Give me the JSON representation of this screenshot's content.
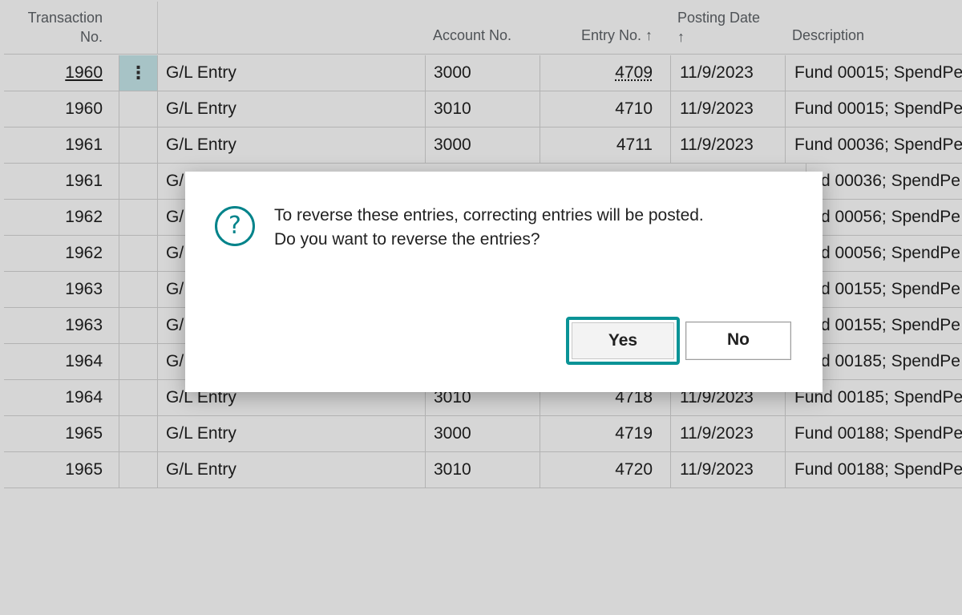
{
  "columns": {
    "transaction_no_line1": "Transaction",
    "transaction_no_line2": "No.",
    "account_no": "Account No.",
    "entry_no": "Entry No.",
    "entry_no_sort": "↑",
    "posting_date_line1": "Posting Date",
    "posting_date_sort": "↑",
    "description": "Description"
  },
  "rows": [
    {
      "transaction_no": "1960",
      "type": "G/L Entry",
      "account_no": "3000",
      "entry_no": "4709",
      "posting_date": "11/9/2023",
      "description": "Fund 00015; SpendPe"
    },
    {
      "transaction_no": "1960",
      "type": "G/L Entry",
      "account_no": "3010",
      "entry_no": "4710",
      "posting_date": "11/9/2023",
      "description": "Fund 00015; SpendPe"
    },
    {
      "transaction_no": "1961",
      "type": "G/L Entry",
      "account_no": "3000",
      "entry_no": "4711",
      "posting_date": "11/9/2023",
      "description": "Fund 00036; SpendPe"
    },
    {
      "transaction_no": "1961",
      "type": "G/",
      "account_no": "",
      "entry_no": "",
      "posting_date": "",
      "description": "d 00036; SpendPe"
    },
    {
      "transaction_no": "1962",
      "type": "G/",
      "account_no": "",
      "entry_no": "",
      "posting_date": "",
      "description": "d 00056; SpendPe"
    },
    {
      "transaction_no": "1962",
      "type": "G/",
      "account_no": "",
      "entry_no": "",
      "posting_date": "",
      "description": "d 00056; SpendPe"
    },
    {
      "transaction_no": "1963",
      "type": "G/",
      "account_no": "",
      "entry_no": "",
      "posting_date": "",
      "description": "d 00155; SpendPe"
    },
    {
      "transaction_no": "1963",
      "type": "G/",
      "account_no": "",
      "entry_no": "",
      "posting_date": "",
      "description": "d 00155; SpendPe"
    },
    {
      "transaction_no": "1964",
      "type": "G/",
      "account_no": "",
      "entry_no": "",
      "posting_date": "",
      "description": "d 00185; SpendPe"
    },
    {
      "transaction_no": "1964",
      "type": "G/L Entry",
      "account_no": "3010",
      "entry_no": "4718",
      "posting_date": "11/9/2023",
      "description": "Fund 00185; SpendPe"
    },
    {
      "transaction_no": "1965",
      "type": "G/L Entry",
      "account_no": "3000",
      "entry_no": "4719",
      "posting_date": "11/9/2023",
      "description": "Fund 00188; SpendPe"
    },
    {
      "transaction_no": "1965",
      "type": "G/L Entry",
      "account_no": "3010",
      "entry_no": "4720",
      "posting_date": "11/9/2023",
      "description": "Fund 00188; SpendPe"
    }
  ],
  "row_menu_glyph": "⋮",
  "dialog": {
    "icon": "question-icon",
    "icon_glyph": "?",
    "message_line1": "To reverse these entries, correcting entries will be posted.",
    "message_line2": "Do you want to reverse the entries?",
    "yes_label": "Yes",
    "no_label": "No"
  },
  "colors": {
    "accent": "#0a9396",
    "selected_cell": "#c8e9ec"
  }
}
